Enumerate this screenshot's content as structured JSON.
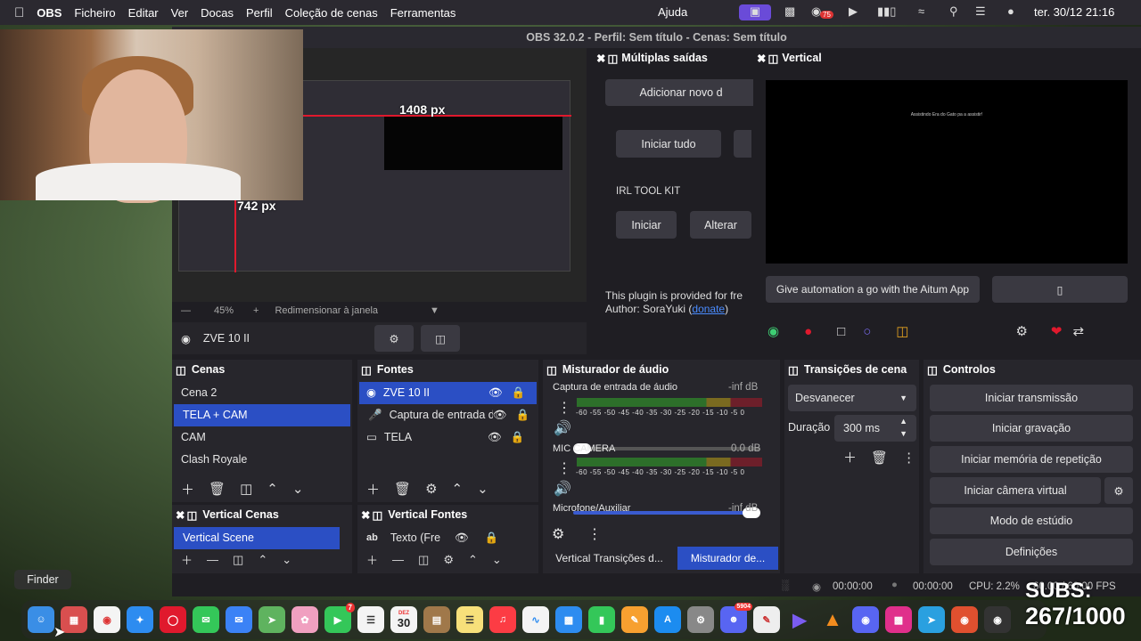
{
  "menubar": {
    "app_name": "OBS",
    "items": [
      "Ficheiro",
      "Editar",
      "Ver",
      "Docas",
      "Perfil",
      "Coleção de cenas",
      "Ferramentas"
    ],
    "help": "Ajuda",
    "tray_badge": "75",
    "clock": "ter. 30/12  21:16"
  },
  "window": {
    "title": "OBS 32.0.2 - Perfil: Sem título - Cenas: Sem título"
  },
  "preview": {
    "dim_width": "1408 px",
    "dim_height": "742 px",
    "zoom": "45%",
    "resize_label": "Redimensionar à janela"
  },
  "source_bar": {
    "source_name": "ZVE 10 II"
  },
  "multiplas": {
    "title": "Múltiplas saídas",
    "add_new": "Adicionar novo d",
    "start_all": "Iniciar tudo",
    "irl_kit": "IRL TOOL KIT",
    "start": "Iniciar",
    "change": "Alterar",
    "plugin_text": "This plugin is provided for fre",
    "author_label": "Author: SoraYuki (",
    "donate": "donate",
    "author_end": ")"
  },
  "vertical": {
    "title": "Vertical",
    "preview_text": "Assistindo Era do Gato pa a assistir!",
    "aitum_button": "Give automation a go with the Aitum App",
    "empty_button": "▯"
  },
  "scenes": {
    "title": "Cenas",
    "items": [
      "Cena 2",
      "TELA + CAM",
      "CAM",
      "Clash Royale"
    ],
    "selected_index": 1
  },
  "sources": {
    "title": "Fontes",
    "items": [
      "ZVE 10 II",
      "Captura de entrada d",
      "TELA"
    ]
  },
  "mixer": {
    "title": "Misturador de áudio",
    "channels": [
      {
        "name": "Captura de entrada de áudio",
        "level": "-inf dB",
        "volume": 0.05
      },
      {
        "name": "MIC CAMERA",
        "level": "0.0 dB",
        "volume": 1.0
      },
      {
        "name": "Microfone/Auxiliar",
        "level": "-inf dB",
        "volume": 0.0
      }
    ],
    "scale": "-60 -55 -50 -45 -40 -35 -30 -25 -20 -15 -10 -5 0",
    "tab_vertical": "Vertical Transições d...",
    "tab_mixer": "Misturador de..."
  },
  "transitions": {
    "title": "Transições de cena",
    "type": "Desvanecer",
    "duration_label": "Duração",
    "duration": "300 ms"
  },
  "controls": {
    "title": "Controlos",
    "start_stream": "Iniciar transmissão",
    "start_record": "Iniciar gravação",
    "start_replay": "Iniciar memória de repetição",
    "start_vcam": "Iniciar câmera virtual",
    "studio_mode": "Modo de estúdio",
    "settings": "Definições"
  },
  "vertical_scenes": {
    "title": "Vertical Cenas",
    "items": [
      "Vertical Scene"
    ]
  },
  "vertical_sources": {
    "title": "Vertical Fontes",
    "items": [
      "Texto (Fre"
    ]
  },
  "status": {
    "rec_time": "00:00:00",
    "stream_time": "00:00:00",
    "cpu": "CPU: 2.2%",
    "fps": "60.00 / 60.00 FPS"
  },
  "dock": {
    "calendar_month": "DEZ",
    "calendar_day": "30",
    "facetime_badge": "7",
    "discord_badge": "5904"
  },
  "tooltip": {
    "finder": "Finder"
  },
  "overlay": {
    "subs_label": "SUBS:",
    "subs_count": "267/1000"
  },
  "colors": {
    "accent": "#2b4fc4",
    "record_red": "#e0192d",
    "link_blue": "#4a8cff"
  }
}
